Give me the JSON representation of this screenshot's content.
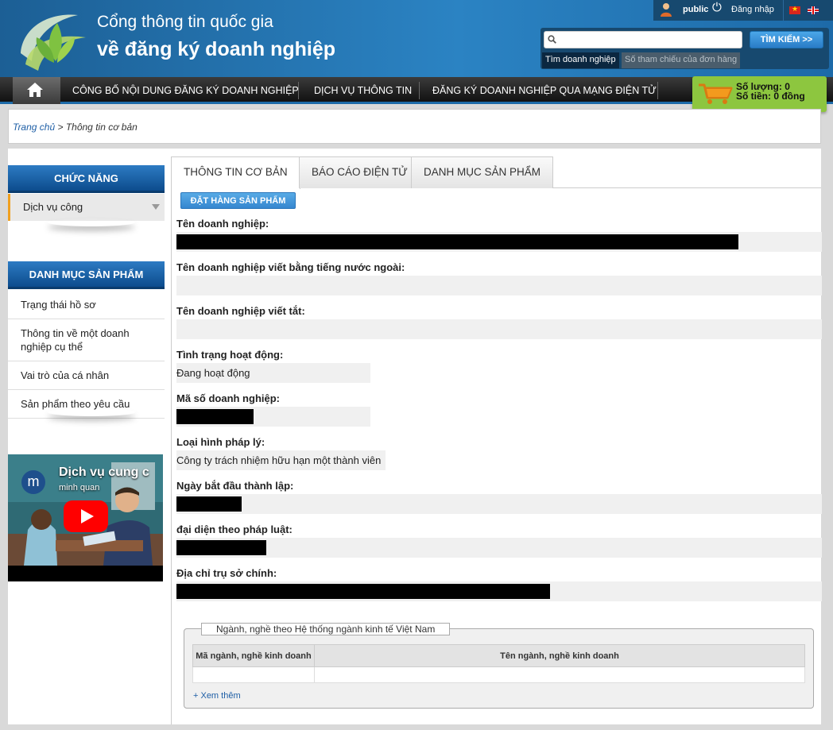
{
  "header": {
    "title_line1": "Cổng thông tin quốc gia",
    "title_line2": "về đăng ký doanh nghiệp",
    "user_name": "public",
    "login_label": "Đăng nhập",
    "icons": {
      "user": "user-icon",
      "power": "power-icon",
      "flags": [
        "vietnam-flag-icon",
        "uk-flag-icon"
      ]
    }
  },
  "search": {
    "placeholder": "",
    "button_label": "TÌM KIẾM >>",
    "tabs": [
      "Tìm doanh nghiệp",
      "Số tham chiếu của đơn hàng"
    ]
  },
  "nav": {
    "items": [
      "CÔNG BỐ NỘI DUNG ĐĂNG KÝ DOANH NGHIỆP",
      "DỊCH VỤ THÔNG TIN",
      "ĐĂNG KÝ DOANH NGHIỆP QUA MẠNG ĐIỆN TỬ"
    ]
  },
  "cart": {
    "quantity": "Số lượng: 0",
    "total": "Số tiền: 0 đồng"
  },
  "breadcrumb": {
    "home": "Trang chủ",
    "separator": " > ",
    "current": "Thông tin cơ bản"
  },
  "sidebar": {
    "functions_title": "CHỨC NĂNG",
    "public_service": "Dịch vụ công",
    "products_title": "DANH MỤC SẢN PHẨM",
    "items": [
      {
        "label": "Trạng thái hồ sơ"
      },
      {
        "label": "Thông tin về một doanh nghiệp cụ thể"
      },
      {
        "label": "Vai trò của cá nhân"
      },
      {
        "label": "Sản phẩm theo yêu cầu"
      }
    ],
    "video": {
      "title": "Dịch vụ cung c",
      "channel": "minh quan",
      "avatar_letter": "m"
    }
  },
  "tabs": [
    "THÔNG TIN CƠ BẢN",
    "BÁO CÁO ĐIỆN TỬ",
    "DANH MỤC SẢN PHẨM"
  ],
  "order_button": "ĐẶT HÀNG SẢN PHẨM",
  "fields": {
    "name": {
      "label": "Tên doanh nghiệp:",
      "value": ""
    },
    "foreign_name": {
      "label": "Tên doanh nghiệp viết bằng tiếng nước ngoài:",
      "value": ""
    },
    "short_name": {
      "label": "Tên doanh nghiệp viết tắt:",
      "value": ""
    },
    "status": {
      "label": "Tình trạng hoạt động:",
      "value": "Đang hoạt động"
    },
    "code": {
      "label": "Mã số doanh nghiệp:",
      "value": ""
    },
    "legal_type": {
      "label": "Loại hình pháp lý:",
      "value": "Công ty trách nhiệm hữu hạn một thành viên"
    },
    "founded": {
      "label": "Ngày bắt đầu thành lập:",
      "value": ""
    },
    "representative": {
      "label": "đại diện theo pháp luật:",
      "value": ""
    },
    "address": {
      "label": "Địa chỉ trụ sở chính:",
      "value": ""
    }
  },
  "industry": {
    "legend": "Ngành, nghề theo Hệ thống ngành kinh tế Việt Nam",
    "columns": [
      "Mã ngành, nghề kinh doanh",
      "Tên ngành, nghề kinh doanh"
    ],
    "see_more": "+ Xem thêm"
  },
  "colors": {
    "header_blue": "#2b83c3",
    "sidebar_head": "#1a63a8",
    "cart_green": "#8dc63f",
    "accent_orange": "#f0a020"
  }
}
